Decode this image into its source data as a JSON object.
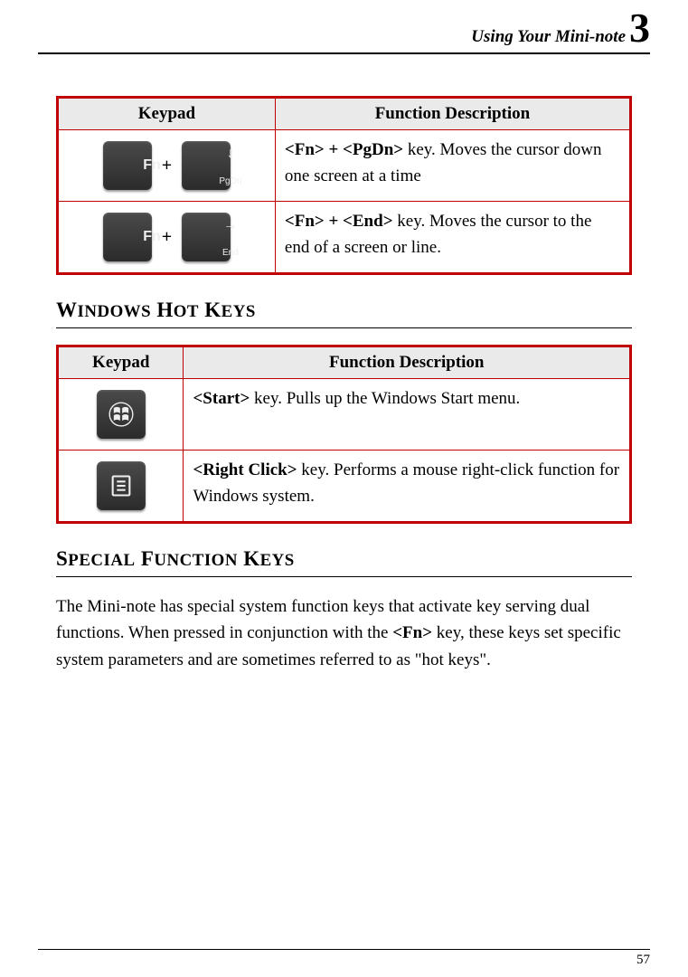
{
  "header": {
    "chapter_title": "Using Your Mini-note",
    "chapter_number": "3"
  },
  "table1": {
    "col_keypad": "Keypad",
    "col_desc": "Function Description",
    "rows": [
      {
        "keys": [
          "Fn",
          "PgDn"
        ],
        "arrow": "↓",
        "bold": "<Fn> + <PgDn>",
        "rest": " key. Moves the cursor down one screen at a time"
      },
      {
        "keys": [
          "Fn",
          "End"
        ],
        "arrow": "→",
        "bold": "<Fn> + <End>",
        "rest": " key. Moves the cursor to the end of a screen or line."
      }
    ]
  },
  "section_windows": "WINDOWS HOT KEYS",
  "table2": {
    "col_keypad": "Keypad",
    "col_desc": "Function Description",
    "rows": [
      {
        "icon": "windows",
        "bold": "<Start>",
        "rest": " key. Pulls up the Windows Start menu."
      },
      {
        "icon": "menu",
        "bold": "<Right Click>",
        "rest": " key. Performs a mouse right-click function for Windows system."
      }
    ]
  },
  "section_special": "SPECIAL FUNCTION KEYS",
  "paragraph_pre": "The Mini-note has special system function keys that activate key serving dual functions. When pressed in conjunction with the ",
  "paragraph_bold": "<Fn>",
  "paragraph_post": " key, these keys set specific system parameters and are sometimes referred to as \"hot keys\".",
  "page_number": "57"
}
